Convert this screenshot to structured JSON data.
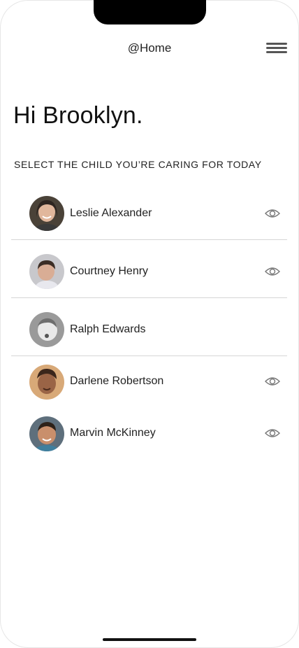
{
  "header": {
    "title": "@Home",
    "menu_icon": "hamburger-menu-icon"
  },
  "greeting": "Hi Brooklyn.",
  "section_label": "SELECT THE CHILD YOU’RE CARING FOR TODAY",
  "children": [
    {
      "name": "Leslie Alexander",
      "has_view_icon": true
    },
    {
      "name": "Courtney Henry",
      "has_view_icon": true
    },
    {
      "name": "Ralph Edwards",
      "has_view_icon": false
    },
    {
      "name": "Darlene Robertson",
      "has_view_icon": true
    },
    {
      "name": "Marvin McKinney",
      "has_view_icon": true
    }
  ],
  "colors": {
    "background": "#ffffff",
    "divider": "#d6d6d6",
    "text": "#222222",
    "icon": "#777777"
  }
}
